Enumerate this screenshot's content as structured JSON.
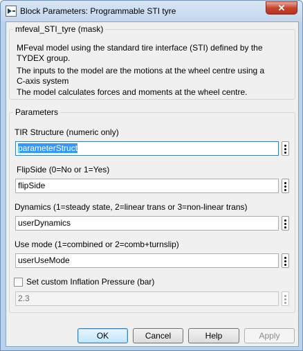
{
  "window": {
    "title": "Block Parameters: Programmable STI tyre",
    "close_glyph": "✕"
  },
  "mask": {
    "group_title": "mfeval_STI_tyre (mask)",
    "description": [
      "MFeval model using the standard tire interface (STI) defined by the",
      "TYDEX group.",
      "The inputs to the model are the motions at the wheel centre using a",
      "C-axis system",
      "The model calculates forces and moments at the wheel centre."
    ]
  },
  "parameters": {
    "group_title": "Parameters",
    "fields": [
      {
        "label": "TIR Structure (numeric only)",
        "value": "parameterStruct"
      },
      {
        "label": "FlipSide (0=No or  1=Yes)",
        "value": "flipSide"
      },
      {
        "label": "Dynamics (1=steady state, 2=linear trans or 3=non-linear trans)",
        "value": "userDynamics"
      },
      {
        "label": "Use mode (1=combined or 2=comb+turnslip)",
        "value": "userUseMode"
      }
    ],
    "inflation": {
      "checkbox_label": "Set custom Inflation Pressure (bar)",
      "checked": false,
      "value": "2.3"
    }
  },
  "buttons": {
    "ok": "OK",
    "cancel": "Cancel",
    "help": "Help",
    "apply": "Apply"
  },
  "icons": {
    "app": "simulink-block-icon",
    "menu": "vertical-ellipsis-icon"
  },
  "colors": {
    "selection": "#3399ff",
    "close_button": "#c7452e",
    "frame": "#b9d1ea"
  }
}
